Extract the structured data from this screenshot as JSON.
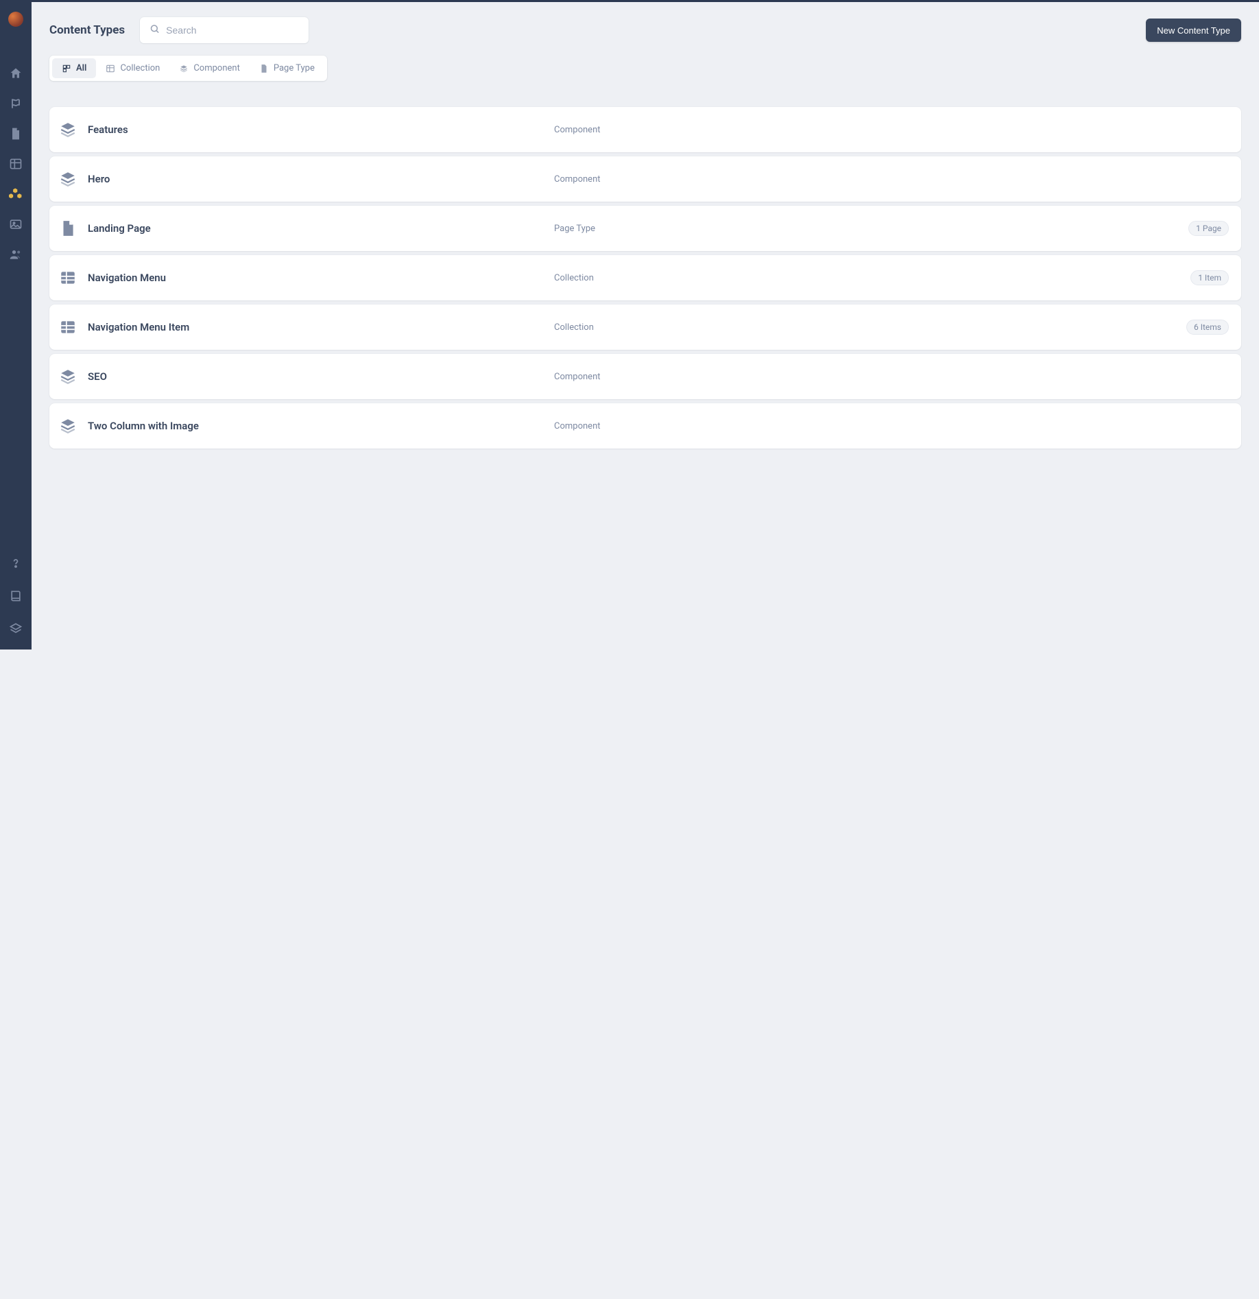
{
  "header": {
    "title": "Content Types",
    "search_placeholder": "Search",
    "new_button_label": "New Content Type"
  },
  "filters": [
    {
      "label": "All",
      "icon": "all",
      "active": true
    },
    {
      "label": "Collection",
      "icon": "collection",
      "active": false
    },
    {
      "label": "Component",
      "icon": "component",
      "active": false
    },
    {
      "label": "Page Type",
      "icon": "page",
      "active": false
    }
  ],
  "rows": [
    {
      "name": "Features",
      "type": "Component",
      "icon": "component",
      "badge": null
    },
    {
      "name": "Hero",
      "type": "Component",
      "icon": "component",
      "badge": null
    },
    {
      "name": "Landing Page",
      "type": "Page Type",
      "icon": "page",
      "badge": "1 Page"
    },
    {
      "name": "Navigation Menu",
      "type": "Collection",
      "icon": "collection",
      "badge": "1 Item"
    },
    {
      "name": "Navigation Menu Item",
      "type": "Collection",
      "icon": "collection",
      "badge": "6 Items"
    },
    {
      "name": "SEO",
      "type": "Component",
      "icon": "component",
      "badge": null
    },
    {
      "name": "Two Column with Image",
      "type": "Component",
      "icon": "component",
      "badge": null
    }
  ],
  "sidebar": {
    "nav": [
      {
        "icon": "home"
      },
      {
        "icon": "blog"
      },
      {
        "icon": "pages"
      },
      {
        "icon": "tables"
      },
      {
        "icon": "types"
      },
      {
        "icon": "media"
      },
      {
        "icon": "users"
      }
    ],
    "active_index": 4,
    "bottom": [
      {
        "icon": "help"
      },
      {
        "icon": "docs"
      },
      {
        "icon": "stack"
      }
    ]
  }
}
